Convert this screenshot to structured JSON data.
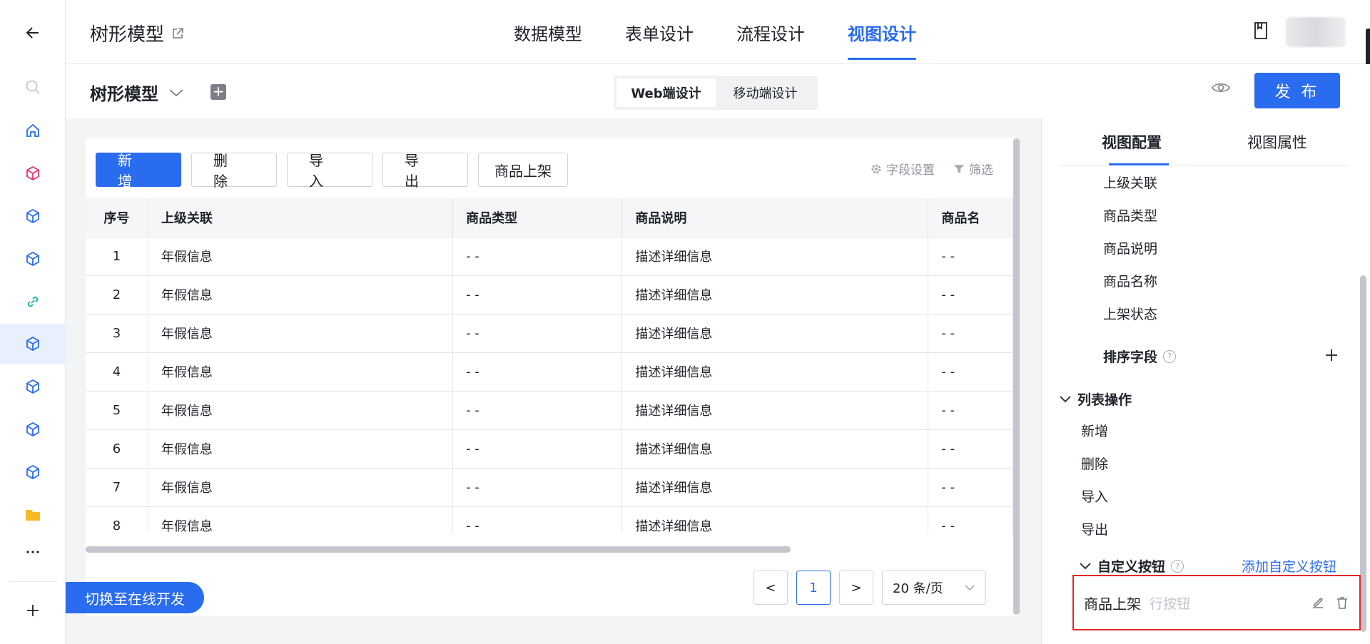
{
  "header": {
    "app_title": "树形模型",
    "nav_tabs": [
      {
        "label": "数据模型",
        "active": false
      },
      {
        "label": "表单设计",
        "active": false
      },
      {
        "label": "流程设计",
        "active": false
      },
      {
        "label": "视图设计",
        "active": true
      }
    ]
  },
  "subbar": {
    "model_name": "树形模型",
    "segments": [
      {
        "label": "Web端设计",
        "active": true
      },
      {
        "label": "移动端设计",
        "active": false
      }
    ],
    "publish_label": "发 布"
  },
  "toolbar": {
    "add_label": "新 增",
    "delete_label": "删 除",
    "import_label": "导 入",
    "export_label": "导 出",
    "custom_label": "商品上架",
    "field_settings_label": "字段设置",
    "filter_label": "筛选"
  },
  "table": {
    "headers": [
      "序号",
      "上级关联",
      "商品类型",
      "商品说明",
      "商品名"
    ],
    "rows": [
      [
        "1",
        "年假信息",
        "- -",
        "描述详细信息",
        "- -"
      ],
      [
        "2",
        "年假信息",
        "- -",
        "描述详细信息",
        "- -"
      ],
      [
        "3",
        "年假信息",
        "- -",
        "描述详细信息",
        "- -"
      ],
      [
        "4",
        "年假信息",
        "- -",
        "描述详细信息",
        "- -"
      ],
      [
        "5",
        "年假信息",
        "- -",
        "描述详细信息",
        "- -"
      ],
      [
        "6",
        "年假信息",
        "- -",
        "描述详细信息",
        "- -"
      ],
      [
        "7",
        "年假信息",
        "- -",
        "描述详细信息",
        "- -"
      ],
      [
        "8",
        "年假信息",
        "- -",
        "描述详细信息",
        "- -"
      ]
    ]
  },
  "pagination": {
    "prev": "<",
    "current_page": "1",
    "next": ">",
    "page_size": "20 条/页"
  },
  "switch_label": "切换至在线开发",
  "panel": {
    "tabs": [
      {
        "label": "视图配置",
        "active": true
      },
      {
        "label": "视图属性",
        "active": false
      }
    ],
    "fields": [
      "上级关联",
      "商品类型",
      "商品说明",
      "商品名称",
      "上架状态"
    ],
    "sort_section": "排序字段",
    "list_ops_section": "列表操作",
    "list_ops": [
      "新增",
      "删除",
      "导入",
      "导出"
    ],
    "custom_section": "自定义按钮",
    "add_custom_link": "添加自定义按钮",
    "custom_button": {
      "name": "商品上架",
      "type": "行按钮"
    }
  },
  "colors": {
    "accent": "#2a6cf0",
    "highlight_border": "#e5262a"
  }
}
